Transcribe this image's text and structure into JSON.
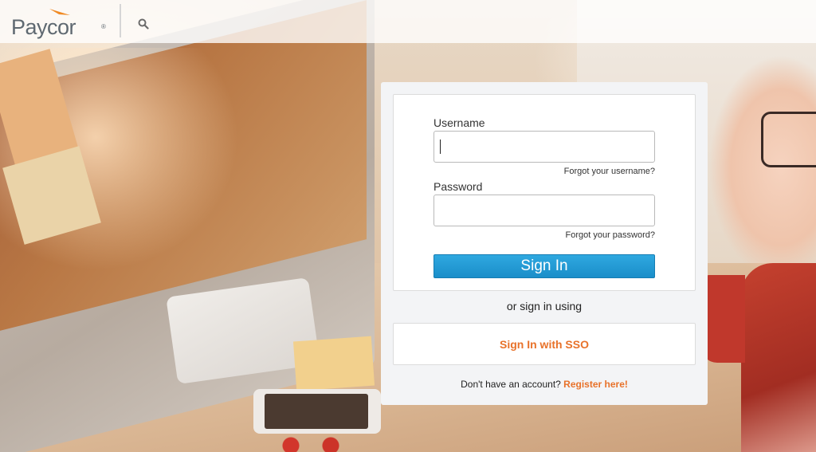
{
  "header": {
    "logo_text": "Paycor",
    "logo_reg": "®",
    "search_icon": "search-icon"
  },
  "login": {
    "username_label": "Username",
    "username_value": "",
    "forgot_username": "Forgot your username?",
    "password_label": "Password",
    "password_value": "",
    "forgot_password": "Forgot your password?",
    "sign_in_label": "Sign In",
    "or_text": "or sign in using",
    "sso_label": "Sign In with SSO",
    "register_prompt": "Don't have an account?",
    "register_link": "Register here!"
  },
  "colors": {
    "accent_orange": "#e8722a",
    "button_blue": "#1a8ec9",
    "logo_gray": "#5f6971"
  }
}
